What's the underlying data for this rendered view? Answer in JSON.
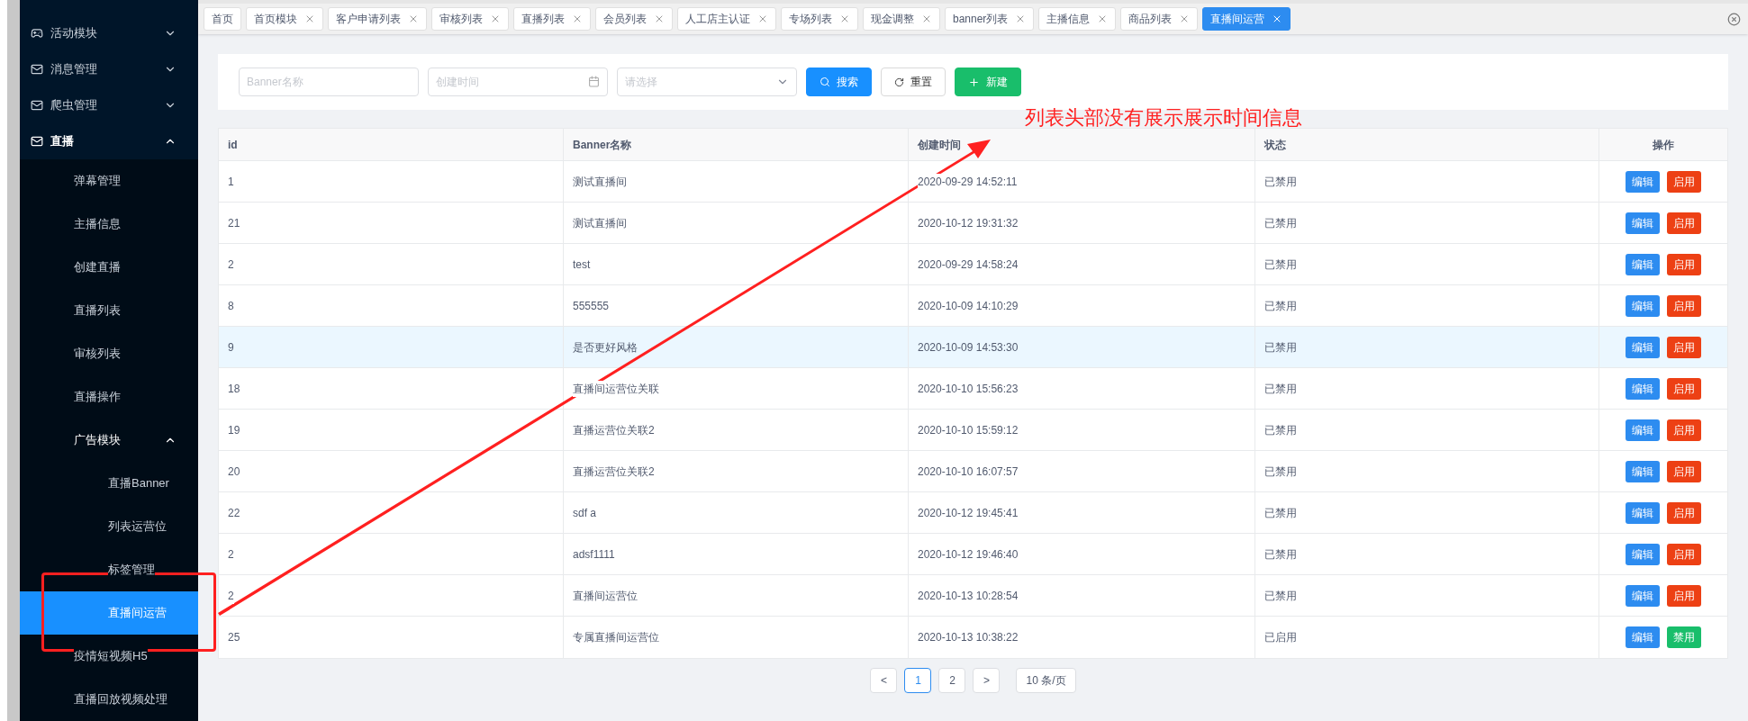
{
  "sidebar": {
    "items": [
      {
        "label": "活动模块",
        "expanded": false
      },
      {
        "label": "消息管理",
        "expanded": false
      },
      {
        "label": "爬虫管理",
        "expanded": false
      },
      {
        "label": "直播",
        "expanded": true,
        "children": [
          {
            "label": "弹幕管理",
            "selected": false
          },
          {
            "label": "主播信息",
            "selected": false
          },
          {
            "label": "创建直播",
            "selected": false
          },
          {
            "label": "直播列表",
            "selected": false
          },
          {
            "label": "审核列表",
            "selected": false
          },
          {
            "label": "直播操作",
            "selected": false
          },
          {
            "label": "广告模块",
            "expanded": true,
            "selected": false,
            "children": [
              {
                "label": "直播Banner",
                "selected": false
              },
              {
                "label": "列表运营位",
                "selected": false
              },
              {
                "label": "标签管理",
                "selected": false
              },
              {
                "label": "直播间运营",
                "selected": true
              }
            ]
          },
          {
            "label": "疫情短视频H5",
            "selected": false
          },
          {
            "label": "直播回放视频处理",
            "selected": false
          }
        ]
      }
    ]
  },
  "tabs": [
    {
      "label": "首页",
      "closable": false,
      "selected": false
    },
    {
      "label": "首页模块",
      "closable": true,
      "selected": false
    },
    {
      "label": "客户申请列表",
      "closable": true,
      "selected": false
    },
    {
      "label": "审核列表",
      "closable": true,
      "selected": false
    },
    {
      "label": "直播列表",
      "closable": true,
      "selected": false
    },
    {
      "label": "会员列表",
      "closable": true,
      "selected": false
    },
    {
      "label": "人工店主认证",
      "closable": true,
      "selected": false
    },
    {
      "label": "专场列表",
      "closable": true,
      "selected": false
    },
    {
      "label": "现金调整",
      "closable": true,
      "selected": false
    },
    {
      "label": "banner列表",
      "closable": true,
      "selected": false
    },
    {
      "label": "主播信息",
      "closable": true,
      "selected": false
    },
    {
      "label": "商品列表",
      "closable": true,
      "selected": false
    },
    {
      "label": "直播间运营",
      "closable": true,
      "selected": true
    }
  ],
  "filters": {
    "name": {
      "placeholder": "Banner名称"
    },
    "created": {
      "placeholder": "创建时间"
    },
    "status": {
      "placeholder": "请选择"
    },
    "buttons": [
      {
        "label": "搜索",
        "kind": "search"
      },
      {
        "label": "重置",
        "kind": "reset"
      },
      {
        "label": "新建",
        "kind": "create"
      }
    ]
  },
  "table": {
    "columns": [
      "id",
      "Banner名称",
      "创建时间",
      "状态",
      "操作"
    ],
    "rows": [
      {
        "id": "1",
        "name": "测试直播间",
        "created": "2020-09-29 14:52:11",
        "status": "已禁用",
        "selected": false,
        "actions": [
          {
            "label": "编辑",
            "kind": "edit"
          },
          {
            "label": "启用",
            "kind": "enable"
          }
        ]
      },
      {
        "id": "21",
        "name": "测试直播间",
        "created": "2020-10-12 19:31:32",
        "status": "已禁用",
        "selected": false,
        "actions": [
          {
            "label": "编辑",
            "kind": "edit"
          },
          {
            "label": "启用",
            "kind": "enable"
          }
        ]
      },
      {
        "id": "2",
        "name": "test",
        "created": "2020-09-29 14:58:24",
        "status": "已禁用",
        "selected": false,
        "actions": [
          {
            "label": "编辑",
            "kind": "edit"
          },
          {
            "label": "启用",
            "kind": "enable"
          }
        ]
      },
      {
        "id": "8",
        "name": "555555",
        "created": "2020-10-09 14:10:29",
        "status": "已禁用",
        "selected": false,
        "actions": [
          {
            "label": "编辑",
            "kind": "edit"
          },
          {
            "label": "启用",
            "kind": "enable"
          }
        ]
      },
      {
        "id": "9",
        "name": "是否更好风格",
        "created": "2020-10-09 14:53:30",
        "status": "已禁用",
        "selected": true,
        "actions": [
          {
            "label": "编辑",
            "kind": "edit"
          },
          {
            "label": "启用",
            "kind": "enable"
          }
        ]
      },
      {
        "id": "18",
        "name": "直播间运营位关联",
        "created": "2020-10-10 15:56:23",
        "status": "已禁用",
        "selected": false,
        "actions": [
          {
            "label": "编辑",
            "kind": "edit"
          },
          {
            "label": "启用",
            "kind": "enable"
          }
        ]
      },
      {
        "id": "19",
        "name": "直播运营位关联2",
        "created": "2020-10-10 15:59:12",
        "status": "已禁用",
        "selected": false,
        "actions": [
          {
            "label": "编辑",
            "kind": "edit"
          },
          {
            "label": "启用",
            "kind": "enable"
          }
        ]
      },
      {
        "id": "20",
        "name": "直播运营位关联2",
        "created": "2020-10-10 16:07:57",
        "status": "已禁用",
        "selected": false,
        "actions": [
          {
            "label": "编辑",
            "kind": "edit"
          },
          {
            "label": "启用",
            "kind": "enable"
          }
        ]
      },
      {
        "id": "22",
        "name": "sdf a",
        "created": "2020-10-12 19:45:41",
        "status": "已禁用",
        "selected": false,
        "actions": [
          {
            "label": "编辑",
            "kind": "edit"
          },
          {
            "label": "启用",
            "kind": "enable"
          }
        ]
      },
      {
        "id": "2",
        "name": "adsf1111",
        "created": "2020-10-12 19:46:40",
        "status": "已禁用",
        "selected": false,
        "actions": [
          {
            "label": "编辑",
            "kind": "edit"
          },
          {
            "label": "启用",
            "kind": "enable"
          }
        ]
      },
      {
        "id": "2",
        "name": "直播间运营位",
        "created": "2020-10-13 10:28:54",
        "status": "已禁用",
        "selected": false,
        "actions": [
          {
            "label": "编辑",
            "kind": "edit"
          },
          {
            "label": "启用",
            "kind": "enable"
          }
        ]
      },
      {
        "id": "25",
        "name": "专属直播间运营位",
        "created": "2020-10-13 10:38:22",
        "status": "已启用",
        "selected": false,
        "actions": [
          {
            "label": "编辑",
            "kind": "edit"
          },
          {
            "label": "禁用",
            "kind": "disable"
          }
        ]
      }
    ]
  },
  "pagination": {
    "prev": "<",
    "pages": [
      {
        "label": "1",
        "selected": true
      },
      {
        "label": "2",
        "selected": false
      }
    ],
    "next": ">",
    "page_size": "10 条/页"
  },
  "annotation": {
    "text": "列表头部没有展示展示时间信息"
  }
}
